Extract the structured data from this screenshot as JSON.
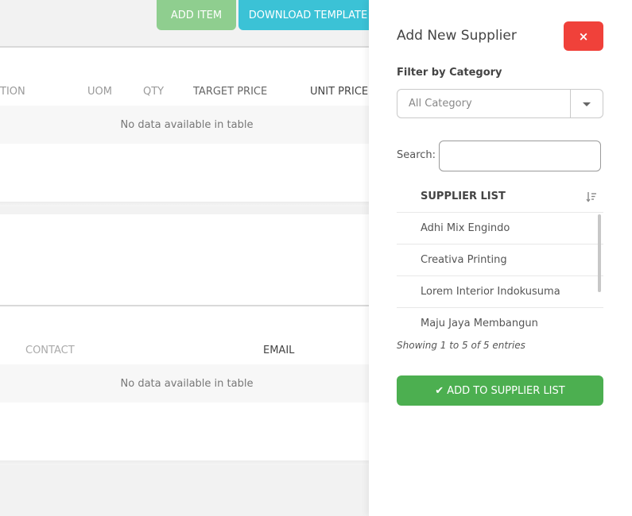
{
  "toolbar": {
    "add_item_label": "ADD ITEM",
    "download_template_label": "DOWNLOAD TEMPLATE"
  },
  "items_table": {
    "headers": [
      "TION",
      "UOM",
      "QTY",
      "TARGET PRICE",
      "UNIT PRICE"
    ],
    "empty_text": "No data available in table"
  },
  "contacts_table": {
    "headers": [
      "CONTACT",
      "EMAIL"
    ],
    "empty_text": "No data available in table"
  },
  "panel": {
    "title": "Add New Supplier",
    "close_symbol": "×",
    "filter_label": "Filter by Category",
    "category_selected": "All Category",
    "search_label": "Search:",
    "search_value": "",
    "list_header": "SUPPLIER LIST",
    "suppliers": [
      "Adhi Mix Engindo",
      "Creativa Printing",
      "Lorem Interior Indokusuma",
      "Maju Jaya Membangun"
    ],
    "info_text": "Showing 1 to 5 of 5 entries",
    "add_button_label": "ADD TO SUPPLIER LIST"
  },
  "colors": {
    "add_item": "#8fce8f",
    "download_template": "#3bc2d6",
    "close": "#f0413a",
    "add_to_list": "#4caf50"
  },
  "icons": {
    "close": "close-icon",
    "caret": "chevron-down-icon",
    "sort": "sort-icon",
    "check": "check-icon"
  }
}
